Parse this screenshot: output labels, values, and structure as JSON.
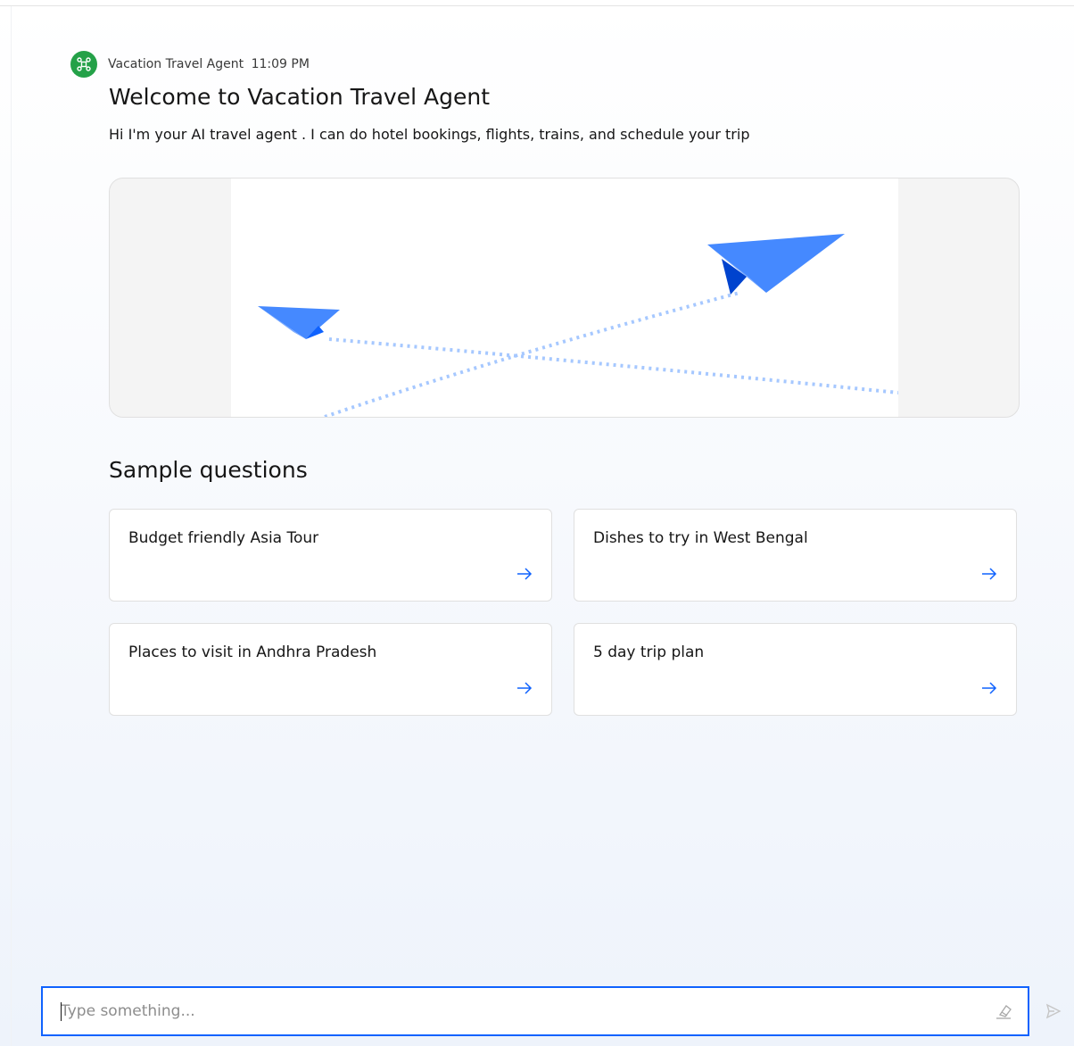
{
  "message": {
    "agent_name": "Vacation Travel Agent",
    "time": "11:09 PM",
    "title": "Welcome to Vacation Travel Agent",
    "text": "Hi I'm your AI travel agent . I can do hotel bookings, flights, trains, and schedule your trip"
  },
  "sample_questions": {
    "heading": "Sample questions",
    "items": [
      {
        "label": "Budget friendly Asia Tour"
      },
      {
        "label": "Dishes to try in West Bengal"
      },
      {
        "label": "Places to visit in Andhra Pradesh"
      },
      {
        "label": "5 day trip plan"
      }
    ]
  },
  "composer": {
    "placeholder": "Type something...",
    "value": ""
  },
  "colors": {
    "accent": "#0f62fe",
    "avatar": "#24a148",
    "plane": "#4589ff",
    "plane_dark": "#0f62fe",
    "trail": "#a6c8ff"
  },
  "icons": {
    "avatar": "agent-network-icon",
    "card_arrow": "arrow-right-icon",
    "clear": "eraser-icon",
    "send": "send-icon"
  }
}
